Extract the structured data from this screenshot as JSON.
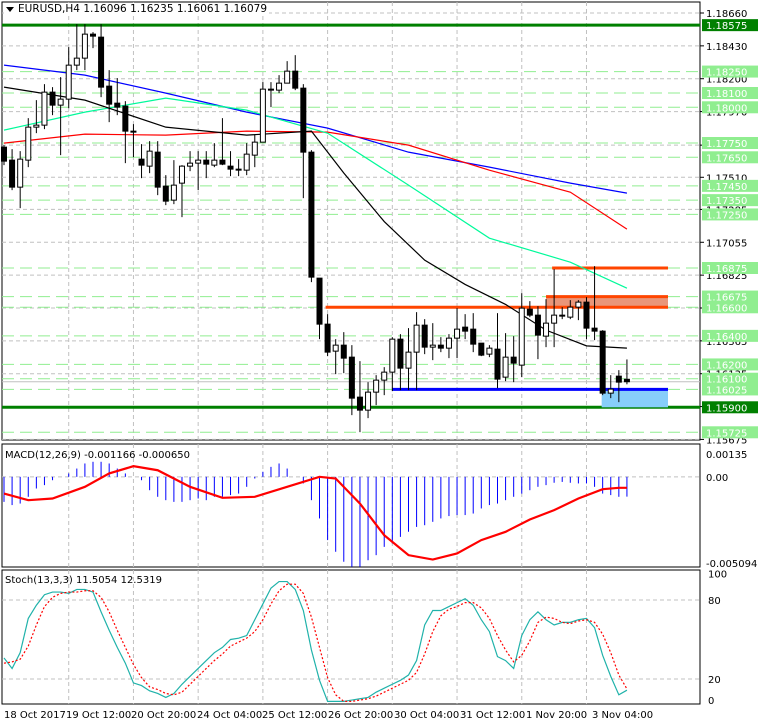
{
  "header": {
    "symbol": "EURUSD,H4",
    "open": "1.16096",
    "high": "1.16235",
    "low": "1.16061",
    "close": "1.16079"
  },
  "colors": {
    "bull": "#ffffff",
    "bear": "#000000",
    "level": "#90ee90",
    "key_level": "#008000",
    "resistance": "#ff4500",
    "support": "#0000ff",
    "support_zone": "#87cefa",
    "resistance_zone": "#e9967a",
    "ma_blue": "#0000ff",
    "ma_red": "#ff0000",
    "ma_green": "#00fa9a",
    "ma_black": "#000000",
    "macd_hist": "#0000ff",
    "macd_signal": "#ff0000",
    "stoch_main": "#20b2aa",
    "stoch_signal": "#ff0000"
  },
  "chart_data": [
    {
      "type": "candlestick",
      "title": "EURUSD,H4",
      "ylim": [
        1.15675,
        1.1866
      ],
      "y_ticks": [
        "1.18660",
        "1.18430",
        "1.18200",
        "1.17970",
        "1.17735",
        "1.17510",
        "1.17285",
        "1.17055",
        "1.16825",
        "1.16595",
        "1.16365",
        "1.16135",
        "1.15905",
        "1.15675"
      ],
      "x_ticks": [
        {
          "bar": 0,
          "label": "18 Oct 2017"
        },
        {
          "bar": 8,
          "label": "19 Oct 12:00"
        },
        {
          "bar": 16,
          "label": "20 Oct 20:00"
        },
        {
          "bar": 24,
          "label": "24 Oct 04:00"
        },
        {
          "bar": 32,
          "label": "25 Oct 12:00"
        },
        {
          "bar": 40,
          "label": "26 Oct 20:00"
        },
        {
          "bar": 48,
          "label": "30 Oct 04:00"
        },
        {
          "bar": 56,
          "label": "31 Oct 12:00"
        },
        {
          "bar": 64,
          "label": "1 Nov 20:00"
        },
        {
          "bar": 72,
          "label": "3 Nov 04:00"
        }
      ],
      "ohlc": [
        [
          1.17721,
          1.17735,
          1.17595,
          1.17623
        ],
        [
          1.1763,
          1.17707,
          1.1742,
          1.17441
        ],
        [
          1.17441,
          1.17693,
          1.17294,
          1.17637
        ],
        [
          1.1763,
          1.17924,
          1.17581,
          1.17861
        ],
        [
          1.17861,
          1.1805,
          1.17819,
          1.17875
        ],
        [
          1.17875,
          1.18162,
          1.17847,
          1.18106
        ],
        [
          1.18106,
          1.18141,
          1.17945,
          1.18015
        ],
        [
          1.18015,
          1.18211,
          1.17665,
          1.18057
        ],
        [
          1.18057,
          1.18421,
          1.17994,
          1.18295
        ],
        [
          1.18295,
          1.18582,
          1.1826,
          1.18344
        ],
        [
          1.18344,
          1.18582,
          1.1826,
          1.18512
        ],
        [
          1.18512,
          1.18526,
          1.18414,
          1.18498
        ],
        [
          1.18491,
          1.18582,
          1.18071,
          1.18141
        ],
        [
          1.18148,
          1.1826,
          1.17896,
          1.18022
        ],
        [
          1.18029,
          1.18204,
          1.17945,
          1.18001
        ],
        [
          1.18008,
          1.18043,
          1.17609,
          1.17833
        ],
        [
          1.17833,
          1.17882,
          1.17651,
          1.17826
        ],
        [
          1.17637,
          1.17742,
          1.17504,
          1.17595
        ],
        [
          1.17588,
          1.17763,
          1.17539,
          1.17693
        ],
        [
          1.17686,
          1.17763,
          1.17385,
          1.17441
        ],
        [
          1.17448,
          1.17525,
          1.17315,
          1.17343
        ],
        [
          1.1735,
          1.1763,
          1.17322,
          1.17455
        ],
        [
          1.17469,
          1.17595,
          1.17231,
          1.17588
        ],
        [
          1.17588,
          1.17693,
          1.17553,
          1.17609
        ],
        [
          1.17609,
          1.17693,
          1.1742,
          1.1763
        ],
        [
          1.1763,
          1.17693,
          1.17504,
          1.17602
        ],
        [
          1.17595,
          1.17749,
          1.17581,
          1.1763
        ],
        [
          1.1763,
          1.17924,
          1.17595,
          1.17602
        ],
        [
          1.17588,
          1.17693,
          1.17518,
          1.17567
        ],
        [
          1.17567,
          1.17637,
          1.17518,
          1.1756
        ],
        [
          1.1756,
          1.17749,
          1.17525,
          1.17672
        ],
        [
          1.17665,
          1.17812,
          1.17581,
          1.17756
        ],
        [
          1.17756,
          1.18176,
          1.17756,
          1.18127
        ],
        [
          1.18127,
          1.18176,
          1.18001,
          1.1812
        ],
        [
          1.1812,
          1.18225,
          1.18099,
          1.18169
        ],
        [
          1.18169,
          1.18323,
          1.18169,
          1.18253
        ],
        [
          1.18253,
          1.18365,
          1.1812,
          1.18134
        ],
        [
          1.18134,
          1.18162,
          1.17364,
          1.17686
        ],
        [
          1.17686,
          1.177,
          1.16776,
          1.16811
        ],
        [
          1.16804,
          1.16804,
          1.16377,
          1.16482
        ],
        [
          1.16482,
          1.16552,
          1.16258,
          1.16286
        ],
        [
          1.16293,
          1.16377,
          1.16132,
          1.16335
        ],
        [
          1.16335,
          1.16426,
          1.16139,
          1.16244
        ],
        [
          1.16251,
          1.16335,
          1.15845,
          1.15964
        ],
        [
          1.15971,
          1.16223,
          1.15726,
          1.1588
        ],
        [
          1.1588,
          1.16076,
          1.15824,
          1.16006
        ],
        [
          1.16006,
          1.16125,
          1.15915,
          1.1609
        ],
        [
          1.1609,
          1.16181,
          1.15985,
          1.16146
        ],
        [
          1.16146,
          1.16391,
          1.16013,
          1.16377
        ],
        [
          1.16377,
          1.16412,
          1.1602,
          1.16174
        ],
        [
          1.16174,
          1.16454,
          1.1602,
          1.16286
        ],
        [
          1.16286,
          1.16566,
          1.1602,
          1.16475
        ],
        [
          1.16475,
          1.16517,
          1.16272,
          1.16321
        ],
        [
          1.16321,
          1.16489,
          1.1623,
          1.16335
        ],
        [
          1.16335,
          1.16391,
          1.16286,
          1.16314
        ],
        [
          1.16314,
          1.16412,
          1.16244,
          1.16384
        ],
        [
          1.16384,
          1.16594,
          1.16244,
          1.16447
        ],
        [
          1.16461,
          1.16552,
          1.16377,
          1.16433
        ],
        [
          1.16447,
          1.16559,
          1.16286,
          1.16342
        ],
        [
          1.16349,
          1.16349,
          1.16258,
          1.16265
        ],
        [
          1.16272,
          1.16335,
          1.16251,
          1.16314
        ],
        [
          1.16307,
          1.16559,
          1.16034,
          1.16097
        ],
        [
          1.16111,
          1.16419,
          1.16083,
          1.16251
        ],
        [
          1.16251,
          1.16398,
          1.16076,
          1.16209
        ],
        [
          1.16195,
          1.16699,
          1.16111,
          1.16594
        ],
        [
          1.16587,
          1.16643,
          1.16531,
          1.16545
        ],
        [
          1.16545,
          1.16608,
          1.16237,
          1.16405
        ],
        [
          1.16398,
          1.16657,
          1.16321,
          1.16489
        ],
        [
          1.16489,
          1.16867,
          1.16321,
          1.16545
        ],
        [
          1.16538,
          1.16601,
          1.16517,
          1.16545
        ],
        [
          1.16531,
          1.1665,
          1.16517,
          1.16601
        ],
        [
          1.16601,
          1.1665,
          1.1651,
          1.16636
        ],
        [
          1.16636,
          1.16671,
          1.16377,
          1.16454
        ],
        [
          1.16454,
          1.16888,
          1.1637,
          1.16433
        ],
        [
          1.16433,
          1.1644,
          1.15985,
          1.15999
        ],
        [
          1.15999,
          1.16125,
          1.15964,
          1.16027
        ],
        [
          1.16118,
          1.1616,
          1.15936,
          1.16076
        ],
        [
          1.16096,
          1.16235,
          1.16061,
          1.16079
        ]
      ],
      "moving_averages": [
        {
          "name": "ma_blue",
          "bars": [
            0,
            10,
            20,
            30,
            40,
            50,
            60,
            70,
            77
          ],
          "values": [
            1.18295,
            1.18225,
            1.18099,
            1.17966,
            1.17854,
            1.17686,
            1.17581,
            1.17469,
            1.17399
          ]
        },
        {
          "name": "ma_red",
          "bars": [
            0,
            10,
            20,
            30,
            40,
            50,
            60,
            70,
            77
          ],
          "values": [
            1.17749,
            1.17812,
            1.17805,
            1.17833,
            1.17826,
            1.17735,
            1.1756,
            1.17406,
            1.17147
          ]
        },
        {
          "name": "ma_green",
          "bars": [
            0,
            10,
            20,
            30,
            40,
            50,
            60,
            70,
            77
          ],
          "values": [
            1.1784,
            1.17966,
            1.18064,
            1.1798,
            1.17819,
            1.17455,
            1.17084,
            1.16916,
            1.16734
          ]
        },
        {
          "name": "ma_black",
          "bars": [
            0,
            10,
            20,
            30,
            38,
            42,
            47,
            52,
            57,
            62,
            67,
            72,
            77
          ],
          "values": [
            1.18141,
            1.1805,
            1.17861,
            1.17805,
            1.17833,
            1.1754,
            1.172,
            1.1693,
            1.1676,
            1.1662,
            1.1644,
            1.1633,
            1.16314
          ]
        }
      ],
      "levels": [
        {
          "price": "1.18575",
          "key": true
        },
        {
          "price": "1.18250"
        },
        {
          "price": "1.18100"
        },
        {
          "price": "1.18000"
        },
        {
          "price": "1.17750"
        },
        {
          "price": "1.17650"
        },
        {
          "price": "1.17450"
        },
        {
          "price": "1.17350"
        },
        {
          "price": "1.17250"
        },
        {
          "price": "1.16875"
        },
        {
          "price": "1.16675"
        },
        {
          "price": "1.16600"
        },
        {
          "price": "1.16400"
        },
        {
          "price": "1.16200"
        },
        {
          "price": "1.16100"
        },
        {
          "price": "1.16025"
        },
        {
          "price": "1.15900",
          "key": true
        },
        {
          "price": "1.15725"
        }
      ],
      "annotations": {
        "resistance_lines": [
          {
            "price": 1.166,
            "from_bar": 40
          },
          {
            "price": 1.16875,
            "from_bar": 68
          }
        ],
        "resistance_zone": {
          "top": 1.16675,
          "bottom": 1.166,
          "from_bar": 67
        },
        "support_line": {
          "price": 1.16025,
          "from_bar": 48
        },
        "support_zone": {
          "top": 1.16025,
          "bottom": 1.159,
          "from_bar": 74
        }
      }
    },
    {
      "type": "bar",
      "title": "MACD(12,26,9)",
      "main_value": "-0.001166",
      "signal_value": "-0.000650",
      "ylim": [
        -0.005094,
        0.00135
      ],
      "y_ticks": [
        "0.00135",
        "0.00",
        "-0.005094"
      ],
      "histogram": [
        -0.00148,
        -0.00167,
        -0.00158,
        -0.00118,
        -0.00069,
        -0.00049,
        -0.0002,
        0,
        0.0002,
        0.00049,
        0.00079,
        0.00089,
        0.00089,
        0.00079,
        0.00049,
        0.0002,
        0,
        -0.0002,
        -0.00079,
        -0.00118,
        -0.00138,
        -0.00148,
        -0.00148,
        -0.00138,
        -0.00128,
        -0.00138,
        -0.00118,
        -0.00118,
        -0.00108,
        -0.00099,
        -0.00059,
        -0.0001,
        0.0003,
        0.00059,
        0.00079,
        0.00049,
        0,
        -0.00039,
        -0.00138,
        -0.00246,
        -0.00374,
        -0.00443,
        -0.00502,
        -0.00532,
        -0.00532,
        -0.00493,
        -0.00463,
        -0.00414,
        -0.00394,
        -0.00355,
        -0.00325,
        -0.00296,
        -0.00286,
        -0.00266,
        -0.00246,
        -0.00232,
        -0.00226,
        -0.00226,
        -0.00217,
        -0.00187,
        -0.00167,
        -0.00158,
        -0.00138,
        -0.00118,
        -0.00099,
        -0.00079,
        -0.00059,
        -0.00049,
        -0.00035,
        -0.0003,
        -0.00035,
        -0.00039,
        -0.00039,
        -0.00059,
        -0.00099,
        -0.00108,
        -0.00118,
        -0.00117
      ],
      "signal": {
        "bars": [
          0,
          3,
          6,
          10,
          13,
          16,
          19,
          23,
          27,
          31,
          35,
          39,
          41,
          44,
          47,
          50,
          53,
          56,
          59,
          62,
          65,
          68,
          71,
          74,
          76,
          77
        ],
        "values": [
          -0.00099,
          -0.00138,
          -0.00128,
          -0.00059,
          0.0002,
          0.00063,
          0.00039,
          -0.00059,
          -0.00124,
          -0.00118,
          -0.00059,
          0,
          -0.0001,
          -0.00158,
          -0.00345,
          -0.00463,
          -0.00489,
          -0.00453,
          -0.00374,
          -0.00325,
          -0.00252,
          -0.00197,
          -0.00128,
          -0.00073,
          -0.00065,
          -0.00065
        ]
      }
    },
    {
      "type": "line",
      "title": "Stoch(13,3,3)",
      "main_value": "11.5054",
      "signal_value": "12.5319",
      "ylim": [
        0,
        100
      ],
      "y_ticks": [
        "100",
        "80",
        "20",
        "0"
      ],
      "main": [
        36,
        28,
        40,
        66,
        76,
        84,
        86,
        86,
        85,
        88,
        88,
        86,
        71,
        57,
        44,
        32,
        17,
        15,
        11,
        9,
        6,
        9,
        16,
        22,
        28,
        34,
        40,
        44,
        50,
        51,
        53,
        65,
        77,
        89,
        94,
        94,
        88,
        72,
        42,
        19,
        3,
        3,
        3,
        4,
        5,
        6,
        10,
        13,
        16,
        19,
        23,
        34,
        61,
        72,
        72,
        75,
        78,
        81,
        76,
        65,
        56,
        37,
        34,
        28,
        53,
        65,
        71,
        65,
        61,
        63,
        63,
        65,
        66,
        59,
        38,
        22,
        8,
        11.5
      ],
      "signal": [
        32,
        33,
        35,
        45,
        61,
        75,
        82,
        85,
        86,
        86,
        87,
        87,
        82,
        71,
        57,
        44,
        31,
        21,
        14,
        12,
        9,
        8,
        10,
        16,
        22,
        28,
        34,
        39,
        45,
        48,
        51,
        56,
        65,
        77,
        87,
        92,
        92,
        85,
        67,
        44,
        21,
        8,
        3,
        3,
        4,
        5,
        7,
        10,
        13,
        16,
        19,
        25,
        39,
        56,
        68,
        73,
        75,
        78,
        78,
        74,
        66,
        53,
        42,
        33,
        38,
        49,
        63,
        67,
        66,
        63,
        62,
        64,
        65,
        63,
        54,
        40,
        23,
        12.5
      ]
    }
  ]
}
